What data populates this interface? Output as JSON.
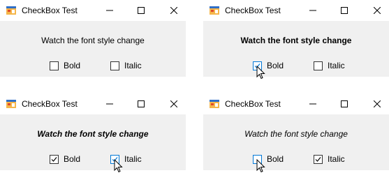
{
  "windows": [
    {
      "title": "CheckBox Test",
      "caption": "Watch the font style change",
      "caption_bold": false,
      "caption_italic": false,
      "bold": {
        "label": "Bold",
        "checked": false
      },
      "italic": {
        "label": "Italic",
        "checked": false
      },
      "cursor_on": ""
    },
    {
      "title": "CheckBox Test",
      "caption": "Watch the font style change",
      "caption_bold": true,
      "caption_italic": false,
      "bold": {
        "label": "Bold",
        "checked": true
      },
      "italic": {
        "label": "Italic",
        "checked": false
      },
      "cursor_on": "bold"
    },
    {
      "title": "CheckBox Test",
      "caption": "Watch the font style change",
      "caption_bold": true,
      "caption_italic": true,
      "bold": {
        "label": "Bold",
        "checked": true
      },
      "italic": {
        "label": "Italic",
        "checked": true
      },
      "cursor_on": "italic"
    },
    {
      "title": "CheckBox Test",
      "caption": "Watch the font style change",
      "caption_bold": false,
      "caption_italic": true,
      "bold": {
        "label": "Bold",
        "checked": false
      },
      "italic": {
        "label": "Italic",
        "checked": true
      },
      "cursor_on": "bold"
    }
  ],
  "colors": {
    "titlebar": "#ffffff",
    "client_area": "#f0f0f0",
    "checkbox_hover_border": "#0078d7"
  },
  "icons": {
    "app": "windows-form-icon",
    "minimize": "minimize-icon",
    "maximize": "maximize-icon",
    "close": "close-icon",
    "check": "checkmark-icon",
    "cursor": "arrow-cursor-icon"
  }
}
